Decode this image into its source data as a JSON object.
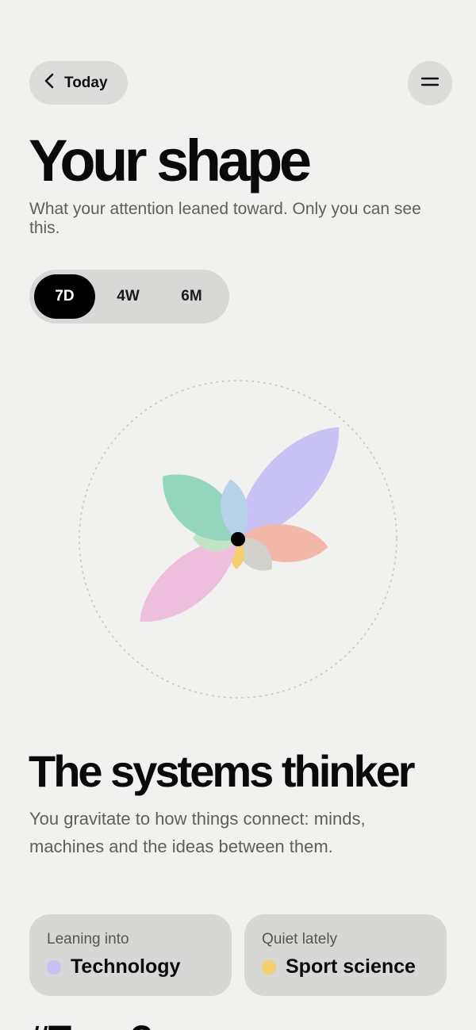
{
  "nav": {
    "back_label": "Today",
    "back_icon": "chevron-left-icon",
    "menu_icon": "menu-icon"
  },
  "header": {
    "title": "Your shape",
    "subtitle": "What your attention leaned toward. Only you can see this."
  },
  "period_selector": {
    "options": [
      "7D",
      "4W",
      "6M"
    ],
    "selected": "7D"
  },
  "shape": {
    "petals": [
      {
        "name": "Technology",
        "color": "#c9c2f4",
        "level": 1.0
      },
      {
        "name": "Coral",
        "color": "#f3b8aa",
        "level": 0.6
      },
      {
        "name": "Grey",
        "color": "#d3d1cb",
        "level": 0.3
      },
      {
        "name": "Sport science",
        "color": "#f3d06e",
        "level": 0.2
      },
      {
        "name": "Pink",
        "color": "#eebfdd",
        "level": 0.85
      },
      {
        "name": "Light green",
        "color": "#c2e4c6",
        "level": 0.3
      },
      {
        "name": "Teal",
        "color": "#94d5be",
        "level": 0.65
      },
      {
        "name": "Blue",
        "color": "#b7d3e9",
        "level": 0.4
      }
    ],
    "center_color": "#000000"
  },
  "persona": {
    "title": "The systems thinker",
    "description": "You gravitate to how things connect: minds, machines and the ideas between them."
  },
  "cards": [
    {
      "label": "Leaning into",
      "value": "Technology",
      "dot_color": "#c9c2f4"
    },
    {
      "label": "Quiet lately",
      "value": "Sport science",
      "dot_color": "#f3d06e"
    }
  ],
  "next_section_peek": "#Tops?"
}
